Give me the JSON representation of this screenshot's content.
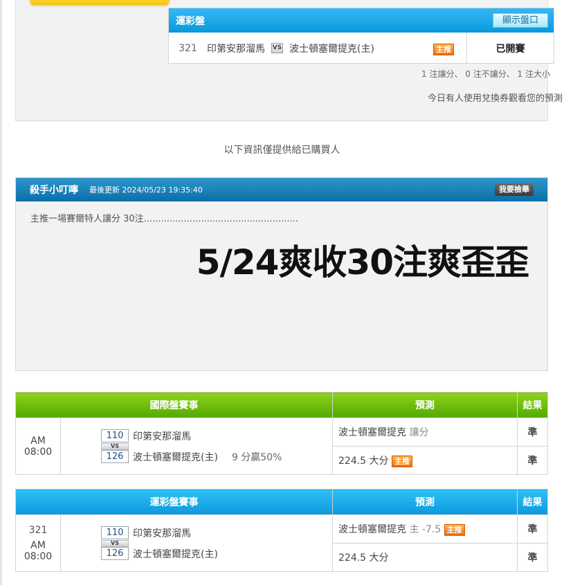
{
  "sport_box": {
    "title": "運彩盤",
    "show_button": "顯示盤口",
    "row": {
      "num": "321",
      "home": "印第安那溜馬",
      "vs": "VS",
      "away": "波士頓塞爾提克(主)",
      "badge": "主推",
      "status": "已開賽"
    }
  },
  "stats_line": "1 注讓分、 0 注不讓分、 1 注大小",
  "voucher_line": "今日有人使用兌換券觀看您的預測",
  "buyers_note": "以下資訊僅提供給已購買人",
  "author": {
    "name": "殺手小叮嚀",
    "updated": "最後更新 2024/05/23 19:35:40",
    "report": "我要檢舉",
    "body": "主推一場賽爾特人讓分 30注......................................................",
    "headline": "5/24爽收30注爽歪歪"
  },
  "intl_table": {
    "headers": [
      "國際盤賽事",
      "預測",
      "結果"
    ],
    "time": "AM 08:00",
    "code_top": "110",
    "vs": "VS",
    "code_bottom": "126",
    "team_top": "印第安那溜馬",
    "team_bottom": "波士頓塞爾提克(主)",
    "handicap": "9 分贏50%",
    "pred1_team": "波士頓塞爾提克",
    "pred1_type": "讓分",
    "pred2": "224.5 大分",
    "pred2_badge": "主推",
    "result1": "準",
    "result2": "準"
  },
  "sport_table": {
    "headers": [
      "運彩盤賽事",
      "預測",
      "結果"
    ],
    "serial": "321",
    "time": "AM 08:00",
    "code_top": "110",
    "vs": "VS",
    "code_bottom": "126",
    "team_top": "印第安那溜馬",
    "team_bottom": "波士頓塞爾提克(主)",
    "pred1_team": "波士頓塞爾提克",
    "pred1_type": "主 -7.5",
    "pred1_badge": "主推",
    "pred2": "224.5 大分",
    "result1": "準",
    "result2": "準"
  }
}
